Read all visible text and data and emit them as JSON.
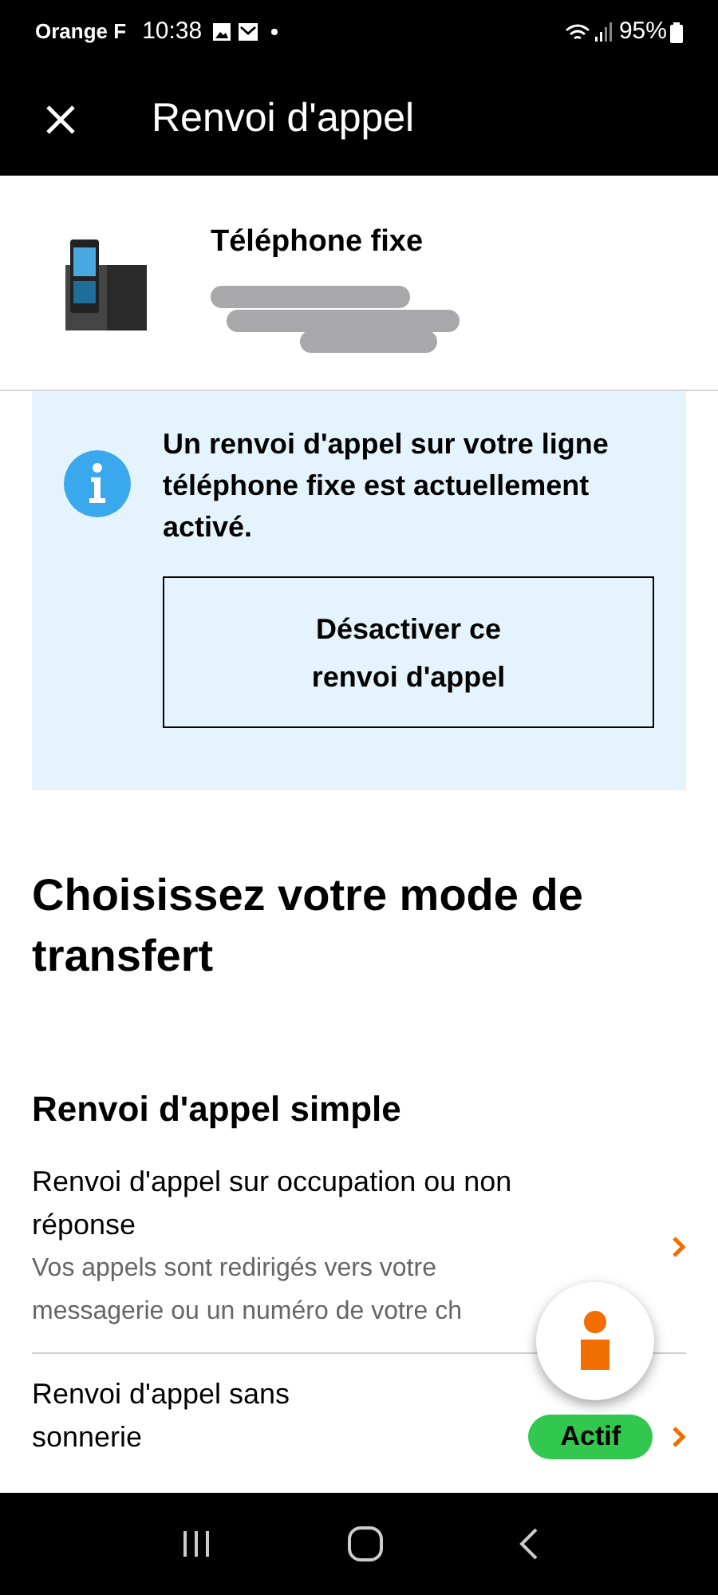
{
  "status_bar": {
    "carrier": "Orange F",
    "time": "10:38",
    "battery": "95%"
  },
  "app_bar": {
    "title": "Renvoi d'appel"
  },
  "line": {
    "title": "Téléphone fixe",
    "redacted": true
  },
  "notice": {
    "text": "Un renvoi d'appel sur votre ligne téléphone fixe est actuellement activé.",
    "button": "Désactiver ce renvoi d'appel"
  },
  "heading": "Choisissez votre mode de transfert",
  "section": {
    "title": "Renvoi d'appel simple",
    "items": [
      {
        "title": "Renvoi d'appel sur occupation ou non réponse",
        "description": "Vos appels sont redirigés vers votre messagerie ou un numéro de votre ch",
        "active": false
      },
      {
        "title": "Renvoi d'appel sans sonnerie",
        "active": true,
        "badge": "Actif"
      }
    ]
  }
}
